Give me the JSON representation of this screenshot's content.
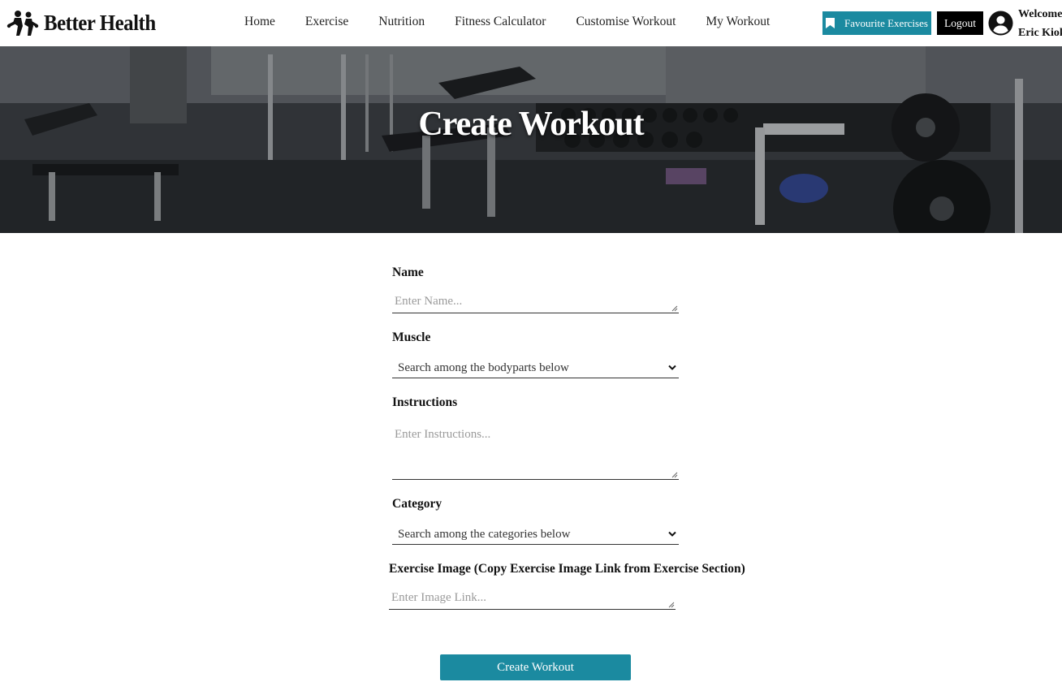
{
  "brand": {
    "name": "Better Health",
    "logo_icon": "people-logo-icon"
  },
  "nav": {
    "links": [
      "Home",
      "Exercise",
      "Nutrition",
      "Fitness Calculator",
      "Customise Workout",
      "My Workout"
    ]
  },
  "header_actions": {
    "favourites_label": "Favourite Exercises",
    "favourites_icon": "bookmark-icon",
    "logout_label": "Logout",
    "user_icon": "user-circle-icon",
    "welcome_line1": "Welcome",
    "welcome_line2": "Eric Kioko"
  },
  "hero": {
    "title": "Create Workout"
  },
  "form": {
    "name": {
      "label": "Name",
      "placeholder": "Enter Name..."
    },
    "muscle": {
      "label": "Muscle",
      "selected": "Search among the bodyparts below"
    },
    "instructions": {
      "label": "Instructions",
      "placeholder": "Enter Instructions..."
    },
    "category": {
      "label": "Category",
      "selected": "Search among the categories below"
    },
    "image": {
      "label": "Exercise Image (Copy Exercise Image Link from Exercise Section)",
      "placeholder": "Enter Image Link..."
    },
    "submit_label": "Create Workout"
  },
  "colors": {
    "accent": "#1b8aa0",
    "dark": "#000000"
  }
}
